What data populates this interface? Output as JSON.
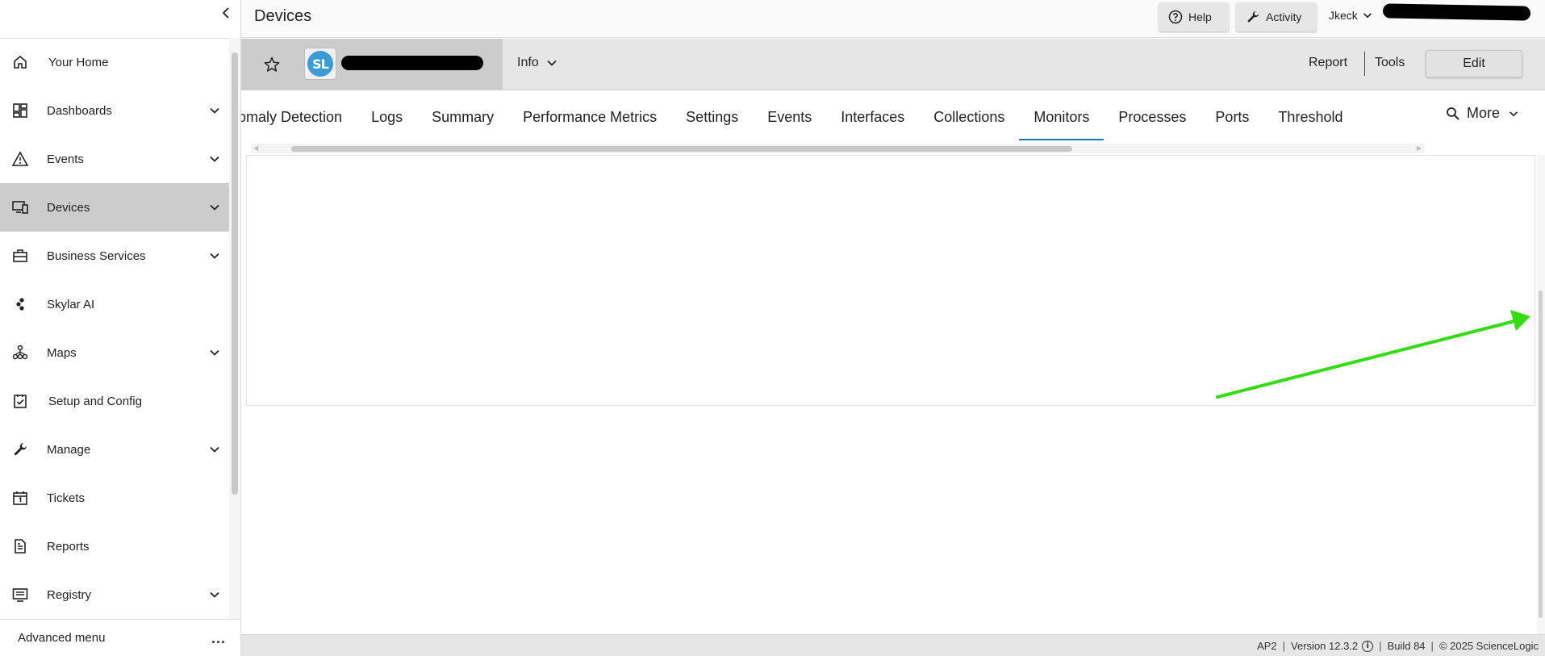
{
  "topbar": {
    "page_title": "Devices",
    "help_label": "Help",
    "activity_label": "Activity",
    "user_name": "Jkeck"
  },
  "sidebar": {
    "items": [
      {
        "label": "Your Home",
        "icon": "home-icon",
        "has_children": false
      },
      {
        "label": "Dashboards",
        "icon": "dashboard-icon",
        "has_children": true
      },
      {
        "label": "Events",
        "icon": "warning-icon",
        "has_children": true
      },
      {
        "label": "Devices",
        "icon": "devices-icon",
        "has_children": true,
        "active": true
      },
      {
        "label": "Business Services",
        "icon": "briefcase-icon",
        "has_children": true
      },
      {
        "label": "Skylar AI",
        "icon": "skylar-icon",
        "has_children": false
      },
      {
        "label": "Maps",
        "icon": "maps-icon",
        "has_children": true
      },
      {
        "label": "Setup and Config",
        "icon": "checklist-icon",
        "has_children": false
      },
      {
        "label": "Manage",
        "icon": "wrench-icon",
        "has_children": true
      },
      {
        "label": "Tickets",
        "icon": "calendar-icon",
        "has_children": false
      },
      {
        "label": "Reports",
        "icon": "document-icon",
        "has_children": false
      },
      {
        "label": "Registry",
        "icon": "registry-icon",
        "has_children": true
      }
    ],
    "advanced_menu_label": "Advanced menu",
    "advanced_menu_dots": "..."
  },
  "device_header": {
    "logo_text": "SL",
    "info_label": "Info",
    "report_label": "Report",
    "tools_label": "Tools",
    "edit_label": "Edit"
  },
  "tabs": {
    "items": [
      {
        "label": "omaly Detection"
      },
      {
        "label": "Logs"
      },
      {
        "label": "Summary"
      },
      {
        "label": "Performance Metrics"
      },
      {
        "label": "Settings"
      },
      {
        "label": "Events"
      },
      {
        "label": "Interfaces"
      },
      {
        "label": "Collections"
      },
      {
        "label": "Monitors",
        "active": true
      },
      {
        "label": "Processes"
      },
      {
        "label": "Ports"
      },
      {
        "label": "Threshold"
      }
    ],
    "more_label": "More"
  },
  "footer": {
    "server": "AP2",
    "version": "Version 12.3.2",
    "build": "Build 84",
    "copyright": "© 2025 ScienceLogic"
  },
  "colors": {
    "active_tab_underline": "#1b7aa6",
    "active_nav_bg": "#cccccc",
    "annotation_arrow": "#33dd11"
  }
}
